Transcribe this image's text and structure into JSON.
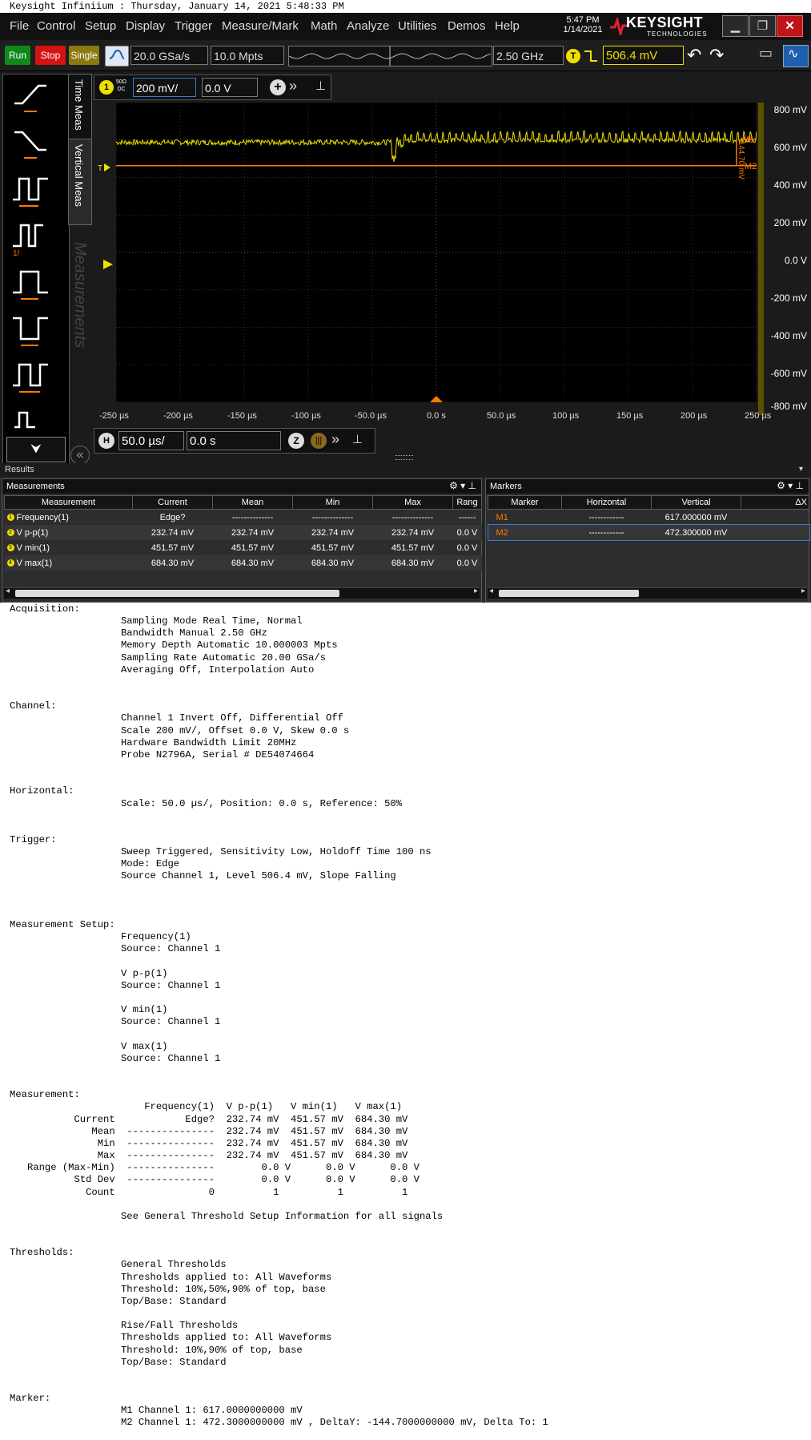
{
  "title_line": "Keysight Infiniium : Thursday, January 14, 2021 5:48:33 PM",
  "menu": [
    "File",
    "Control",
    "Setup",
    "Display",
    "Trigger",
    "Measure/Mark",
    "Math",
    "Analyze",
    "Utilities",
    "Demos",
    "Help"
  ],
  "clock": {
    "time": "5:47 PM",
    "date": "1/14/2021"
  },
  "brand": {
    "name": "KEYSIGHT",
    "sub": "TECHNOLOGIES"
  },
  "toolbar": {
    "run": "Run",
    "stop": "Stop",
    "single": "Single",
    "sample_rate": "20.0 GSa/s",
    "memory": "10.0 Mpts",
    "bandwidth": "2.50 GHz",
    "trigger_badge": "T",
    "trigger_level": "506.4 mV"
  },
  "channel": {
    "badge": "1",
    "coupling_top": "50Ω",
    "coupling_bottom": "DC",
    "scale": "200 mV/",
    "offset": "0.0 V"
  },
  "tabs": {
    "time_meas": "Time Meas",
    "vertical_meas": "Vertical Meas",
    "measurements": "Measurements"
  },
  "horizontal": {
    "badge": "H",
    "scale": "50.0 µs/",
    "position": "0.0 s"
  },
  "grid": {
    "y_labels": [
      "800 mV",
      "600 mV",
      "400 mV",
      "200 mV",
      "0.0 V",
      "-200 mV",
      "-400 mV",
      "-600 mV",
      "-800 mV"
    ],
    "x_labels": [
      "-250 µs",
      "-200 µs",
      "-150 µs",
      "-100 µs",
      "-50.0 µs",
      "0.0 s",
      "50.0 µs",
      "100 µs",
      "150 µs",
      "200 µs",
      "250 µs"
    ],
    "marker_delta": "144.70 mV",
    "marker_m1": "M1",
    "marker_m2": "M2",
    "trace_color": "#f0e000",
    "marker_color": "#ff7a00"
  },
  "results": {
    "title": "Results",
    "measurements_title": "Measurements",
    "markers_title": "Markers",
    "meas_headers": [
      "Measurement",
      "Current",
      "Mean",
      "Min",
      "Max",
      "Rang"
    ],
    "meas_rows": [
      {
        "badge": "1",
        "name": "Frequency(1)",
        "current": "Edge?",
        "mean": "--------------",
        "min": "--------------",
        "max": "--------------",
        "range": "------"
      },
      {
        "badge": "2",
        "name": "V p-p(1)",
        "current": "232.74 mV",
        "mean": "232.74 mV",
        "min": "232.74 mV",
        "max": "232.74 mV",
        "range": "0.0 V"
      },
      {
        "badge": "3",
        "name": "V min(1)",
        "current": "451.57 mV",
        "mean": "451.57 mV",
        "min": "451.57 mV",
        "max": "451.57 mV",
        "range": "0.0 V"
      },
      {
        "badge": "4",
        "name": "V max(1)",
        "current": "684.30 mV",
        "mean": "684.30 mV",
        "min": "684.30 mV",
        "max": "684.30 mV",
        "range": "0.0 V"
      }
    ],
    "marker_headers": [
      "Marker",
      "Horizontal",
      "Vertical",
      "ΔX"
    ],
    "marker_rows": [
      {
        "name": "M1",
        "horizontal": "------------",
        "vertical": "617.000000 mV",
        "dx": ""
      },
      {
        "name": "M2",
        "horizontal": "------------",
        "vertical": "472.300000 mV",
        "dx": ""
      }
    ]
  },
  "report": "Acquisition:\n                   Sampling Mode Real Time, Normal\n                   Bandwidth Manual 2.50 GHz\n                   Memory Depth Automatic 10.000003 Mpts\n                   Sampling Rate Automatic 20.00 GSa/s\n                   Averaging Off, Interpolation Auto\n\n\nChannel:\n                   Channel 1 Invert Off, Differential Off\n                   Scale 200 mV/, Offset 0.0 V, Skew 0.0 s\n                   Hardware Bandwidth Limit 20MHz\n                   Probe N2796A, Serial # DE54074664\n\n\nHorizontal:\n                   Scale: 50.0 µs/, Position: 0.0 s, Reference: 50%\n\n\nTrigger:\n                   Sweep Triggered, Sensitivity Low, Holdoff Time 100 ns\n                   Mode: Edge\n                   Source Channel 1, Level 506.4 mV, Slope Falling\n\n\n\nMeasurement Setup:\n                   Frequency(1)\n                   Source: Channel 1\n\n                   V p-p(1)\n                   Source: Channel 1\n\n                   V min(1)\n                   Source: Channel 1\n\n                   V max(1)\n                   Source: Channel 1\n\n\nMeasurement:\n                       Frequency(1)  V p-p(1)   V min(1)   V max(1)\n           Current            Edge?  232.74 mV  451.57 mV  684.30 mV\n              Mean  ---------------  232.74 mV  451.57 mV  684.30 mV\n               Min  ---------------  232.74 mV  451.57 mV  684.30 mV\n               Max  ---------------  232.74 mV  451.57 mV  684.30 mV\n   Range (Max-Min)  ---------------        0.0 V      0.0 V      0.0 V\n           Std Dev  ---------------        0.0 V      0.0 V      0.0 V\n             Count                0          1          1          1\n\n                   See General Threshold Setup Information for all signals\n\n\nThresholds:\n                   General Thresholds\n                   Thresholds applied to: All Waveforms\n                   Threshold: 10%,50%,90% of top, base\n                   Top/Base: Standard\n\n                   Rise/Fall Thresholds\n                   Thresholds applied to: All Waveforms\n                   Threshold: 10%,90% of top, base\n                   Top/Base: Standard\n\n\nMarker:\n                   M1 Channel 1: 617.0000000000 mV\n                   M2 Channel 1: 472.3000000000 mV , DeltaY: -144.7000000000 mV, Delta To: 1"
}
